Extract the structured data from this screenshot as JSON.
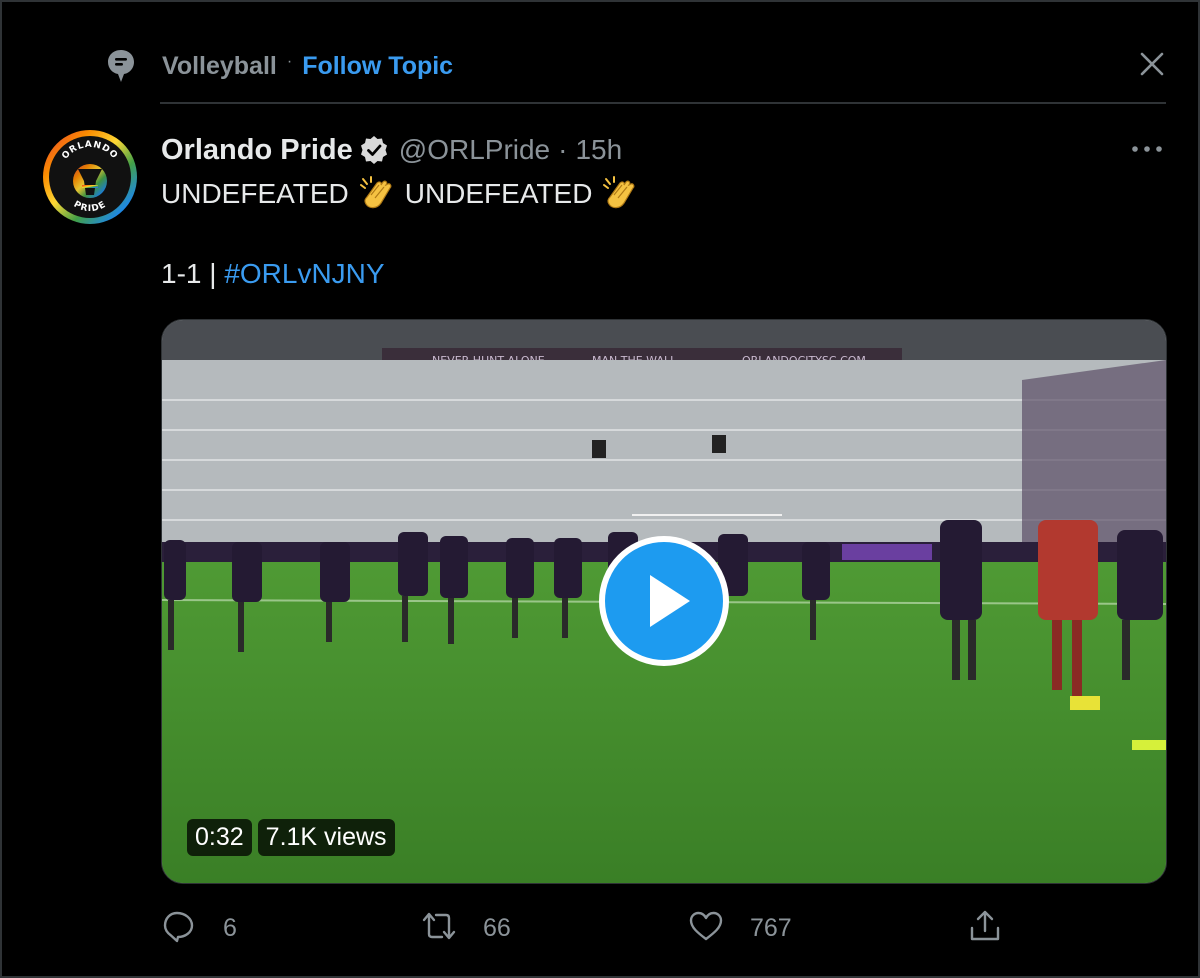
{
  "topic": {
    "name": "Volleyball",
    "separator": "·",
    "follow_label": "Follow Topic"
  },
  "tweet": {
    "display_name": "Orlando Pride",
    "handle": "@ORLPride",
    "separator": "·",
    "time": "15h",
    "avatar_text_top": "ORLANDO",
    "avatar_text_bottom": "PRIDE",
    "line1_a": "UNDEFEATED",
    "line1_b": "UNDEFEATED",
    "line2_text": "1-1 | ",
    "hashtag": "#ORLvNJNY"
  },
  "video": {
    "duration": "0:32",
    "views": "7.1K views",
    "banner_texts": [
      "NEVER HUNT ALONE",
      "MAN THE WALL",
      "ORLANDOCITYSC.COM"
    ]
  },
  "actions": {
    "replies": "6",
    "retweets": "66",
    "likes": "767"
  },
  "colors": {
    "accent": "#3a9bf0",
    "muted": "#8b9399",
    "background": "#000000",
    "pitch": "#3f8a2c"
  },
  "icons": [
    "topic-icon",
    "close-icon",
    "verified-badge-icon",
    "more-icon",
    "clap-emoji-icon",
    "play-icon",
    "reply-icon",
    "retweet-icon",
    "like-icon",
    "share-icon"
  ]
}
